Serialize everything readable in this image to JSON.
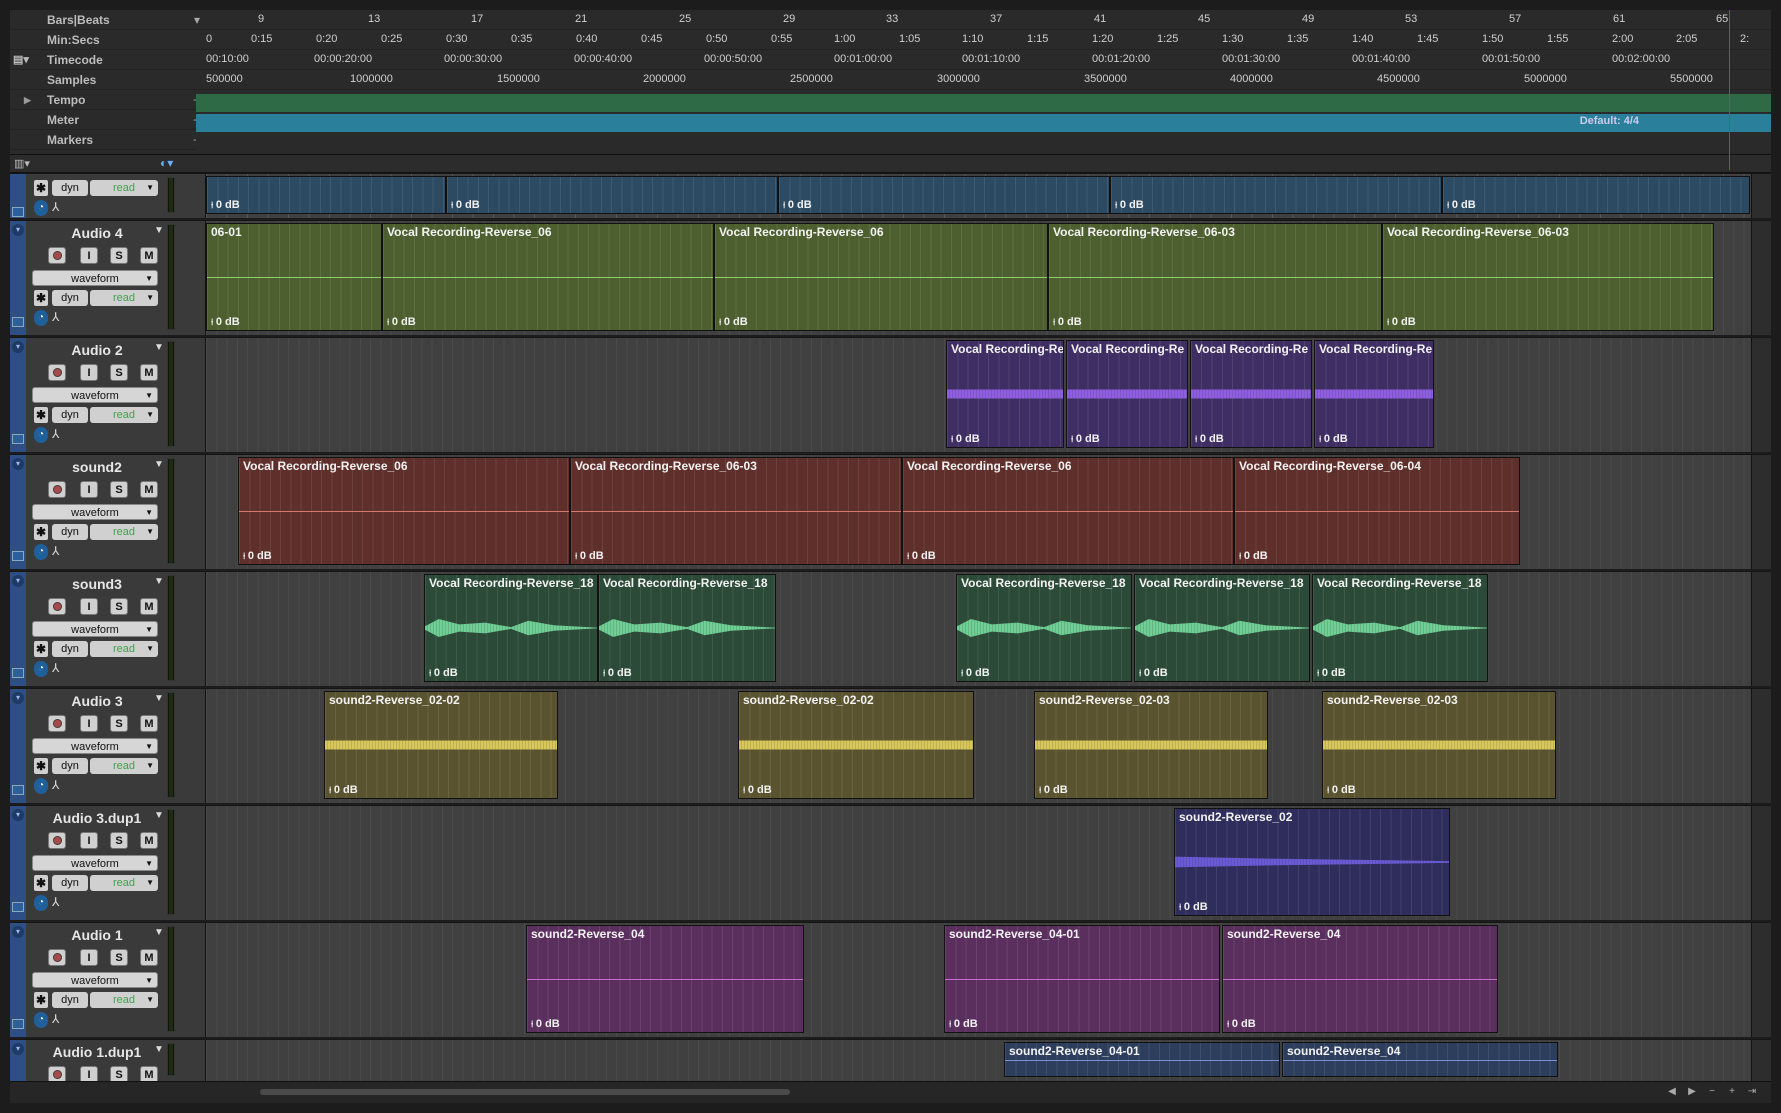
{
  "ruler_labels": {
    "bars": "Bars|Beats",
    "minsecs": "Min:Secs",
    "timecode": "Timecode",
    "samples": "Samples",
    "tempo": "Tempo",
    "meter": "Meter",
    "markers": "Markers"
  },
  "bars_ticks": [
    "9",
    "13",
    "17",
    "21",
    "25",
    "29",
    "33",
    "37",
    "41",
    "45",
    "49",
    "53",
    "57",
    "61",
    "65"
  ],
  "minsecs_ticks": [
    "0",
    "0:15",
    "0:20",
    "0:25",
    "0:30",
    "0:35",
    "0:40",
    "0:45",
    "0:50",
    "0:55",
    "1:00",
    "1:05",
    "1:10",
    "1:15",
    "1:20",
    "1:25",
    "1:30",
    "1:35",
    "1:40",
    "1:45",
    "1:50",
    "1:55",
    "2:00",
    "2:05",
    "2:"
  ],
  "timecode_ticks": [
    "00:10:00",
    "00:00:20:00",
    "00:00:30:00",
    "00:00:40:00",
    "00:00:50:00",
    "00:01:00:00",
    "00:01:10:00",
    "00:01:20:00",
    "00:01:30:00",
    "00:01:40:00",
    "00:01:50:00",
    "00:02:00:00"
  ],
  "samples_ticks": [
    "500000",
    "1000000",
    "1500000",
    "2000000",
    "2500000",
    "3000000",
    "3500000",
    "4000000",
    "4500000",
    "5000000",
    "5500000"
  ],
  "meter_default": "Default: 4/4",
  "tracks": [
    {
      "name": "",
      "mode": "",
      "dyn": "dyn",
      "auto": "read",
      "color": "#2d4a63",
      "clips": [
        {
          "title": "",
          "gain": "0 dB"
        },
        {
          "title": "",
          "gain": "0 dB"
        },
        {
          "title": "",
          "gain": "0 dB"
        },
        {
          "title": "",
          "gain": "0 dB"
        },
        {
          "title": "",
          "gain": "0 dB"
        }
      ]
    },
    {
      "name": "Audio 4",
      "mode": "waveform",
      "dyn": "dyn",
      "auto": "read",
      "color": "#4d5f2e",
      "wave": "#8fcf6a",
      "clips": [
        {
          "title": "06-01",
          "gain": "0 dB"
        },
        {
          "title": "Vocal Recording-Reverse_06",
          "gain": "0 dB"
        },
        {
          "title": "Vocal Recording-Reverse_06",
          "gain": "0 dB"
        },
        {
          "title": "Vocal Recording-Reverse_06-03",
          "gain": "0 dB"
        },
        {
          "title": "Vocal Recording-Reverse_06-03",
          "gain": "0 dB"
        }
      ]
    },
    {
      "name": "Audio 2",
      "mode": "waveform",
      "dyn": "dyn",
      "auto": "read",
      "color": "#3f2e63",
      "wave": "#8e5fe0",
      "clips": [
        {
          "title": "Vocal Recording-Re",
          "gain": "0 dB"
        },
        {
          "title": "Vocal Recording-Re",
          "gain": "0 dB"
        },
        {
          "title": "Vocal Recording-Re",
          "gain": "0 dB"
        },
        {
          "title": "Vocal Recording-Re",
          "gain": "0 dB"
        }
      ]
    },
    {
      "name": "sound2",
      "mode": "waveform",
      "dyn": "dyn",
      "auto": "read",
      "color": "#5e2f2b",
      "wave": "#d07a70",
      "clips": [
        {
          "title": "Vocal Recording-Reverse_06",
          "gain": "0 dB"
        },
        {
          "title": "Vocal Recording-Reverse_06-03",
          "gain": "0 dB"
        },
        {
          "title": "Vocal Recording-Reverse_06",
          "gain": "0 dB"
        },
        {
          "title": "Vocal Recording-Reverse_06-04",
          "gain": "0 dB"
        }
      ]
    },
    {
      "name": "sound3",
      "mode": "waveform",
      "dyn": "dyn",
      "auto": "read",
      "color": "#2c4a38",
      "wave": "#6fcf94",
      "clips": [
        {
          "title": "Vocal Recording-Reverse_18",
          "gain": "0 dB"
        },
        {
          "title": "Vocal Recording-Reverse_18",
          "gain": "0 dB"
        },
        {
          "title": "Vocal Recording-Reverse_18",
          "gain": "0 dB"
        },
        {
          "title": "Vocal Recording-Reverse_18",
          "gain": "0 dB"
        },
        {
          "title": "Vocal Recording-Reverse_18",
          "gain": "0 dB"
        }
      ]
    },
    {
      "name": "Audio 3",
      "mode": "waveform",
      "dyn": "dyn",
      "auto": "read",
      "color": "#5a5330",
      "wave": "#d8c75a",
      "clips": [
        {
          "title": "sound2-Reverse_02-02",
          "gain": "0 dB"
        },
        {
          "title": "sound2-Reverse_02-02",
          "gain": "0 dB"
        },
        {
          "title": "sound2-Reverse_02-03",
          "gain": "0 dB"
        },
        {
          "title": "sound2-Reverse_02-03",
          "gain": "0 dB"
        }
      ]
    },
    {
      "name": "Audio 3.dup1",
      "mode": "waveform",
      "dyn": "dyn",
      "auto": "read",
      "color": "#2e2d5c",
      "wave": "#6b5ad6",
      "clips": [
        {
          "title": "sound2-Reverse_02",
          "gain": "0 dB"
        }
      ]
    },
    {
      "name": "Audio 1",
      "mode": "waveform",
      "dyn": "dyn",
      "auto": "read",
      "color": "#5a2f5e",
      "wave": "#c86ad2",
      "clips": [
        {
          "title": "sound2-Reverse_04",
          "gain": "0 dB"
        },
        {
          "title": "sound2-Reverse_04-01",
          "gain": "0 dB"
        },
        {
          "title": "sound2-Reverse_04",
          "gain": "0 dB"
        }
      ]
    },
    {
      "name": "Audio 1.dup1",
      "mode": "",
      "dyn": "",
      "auto": "",
      "color": "#2d3d5c",
      "wave": "#7a8fd6",
      "clips": [
        {
          "title": "sound2-Reverse_04-01",
          "gain": ""
        },
        {
          "title": "sound2-Reverse_04",
          "gain": ""
        }
      ]
    }
  ],
  "colors": {
    "playhead": "#c0392b",
    "tempo": "#2f6a47",
    "meter": "#2a7f9a"
  }
}
